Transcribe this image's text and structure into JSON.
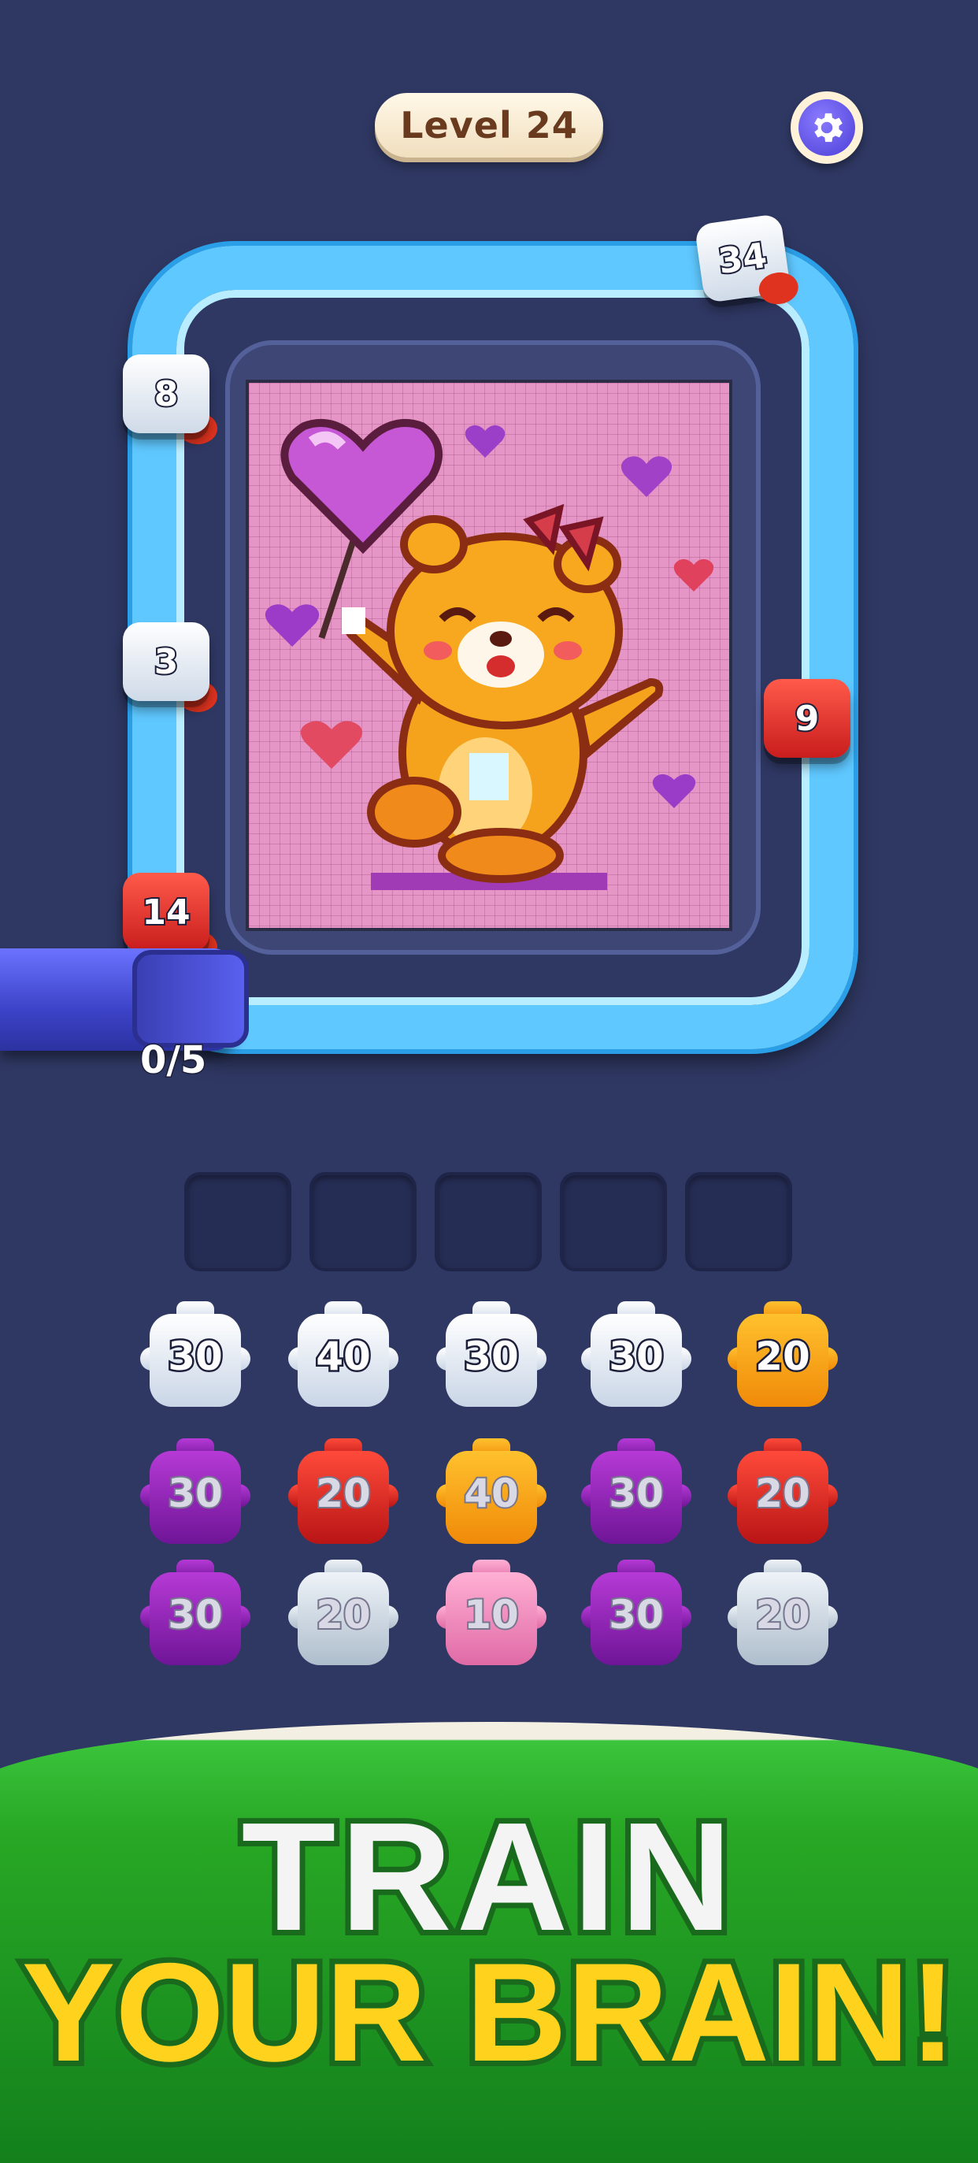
{
  "header": {
    "level_label": "Level 24"
  },
  "belt_cannons": [
    {
      "value": "34",
      "color": "white"
    },
    {
      "value": "8",
      "color": "white"
    },
    {
      "value": "3",
      "color": "white"
    },
    {
      "value": "9",
      "color": "red"
    },
    {
      "value": "14",
      "color": "red"
    }
  ],
  "pipe": {
    "counter": "0/5"
  },
  "queue_slots": 5,
  "shooters": [
    [
      {
        "value": "30",
        "color": "white"
      },
      {
        "value": "40",
        "color": "white"
      },
      {
        "value": "30",
        "color": "white"
      },
      {
        "value": "30",
        "color": "white"
      },
      {
        "value": "20",
        "color": "orange"
      }
    ],
    [
      {
        "value": "30",
        "color": "purple"
      },
      {
        "value": "20",
        "color": "red"
      },
      {
        "value": "40",
        "color": "orange"
      },
      {
        "value": "30",
        "color": "purple"
      },
      {
        "value": "20",
        "color": "red"
      }
    ],
    [
      {
        "value": "30",
        "color": "purple"
      },
      {
        "value": "20",
        "color": "silver"
      },
      {
        "value": "10",
        "color": "pink"
      },
      {
        "value": "30",
        "color": "purple"
      },
      {
        "value": "20",
        "color": "silver"
      }
    ]
  ],
  "banner": {
    "line1": "TRAIN",
    "line2": "YOUR BRAIN!"
  },
  "colors": {
    "background": "#2f3863",
    "belt": "#5fc8ff",
    "canvas": "#e596c6",
    "banner_green": "#28a825",
    "banner_yellow": "#ffd21e"
  }
}
